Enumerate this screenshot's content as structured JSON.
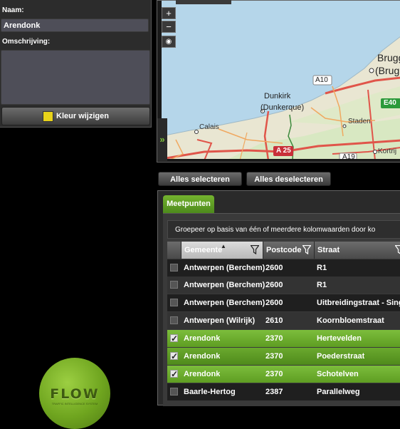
{
  "form": {
    "name_label": "Naam:",
    "name_value": "Arendonk",
    "description_label": "Omschrijving:",
    "description_value": "",
    "color_button_label": "Kleur wijzigen",
    "color_swatch": "#e8d31a"
  },
  "logo": {
    "text": "FLOW",
    "subtext": "TRAFFIC INTELLIGENCE SYSTEM"
  },
  "map": {
    "zoom_in": "+",
    "zoom_out": "−",
    "locate": "◉",
    "expand": "»",
    "labels": {
      "brugge": "Brugge",
      "brugge_local": "(Brug",
      "dunkirk": "Dunkirk",
      "dunkerque": "(Dunkerque)",
      "calais": "Calais",
      "staden": "Staden",
      "kortrijk": "Kortrij",
      "a10": "A10",
      "e40": "E40",
      "a25": "A 25",
      "a19": "A19"
    }
  },
  "actions": {
    "select_all": "Alles selecteren",
    "deselect_all": "Alles deselecteren"
  },
  "grid": {
    "tab_label": "Meetpunten",
    "group_hint": "Groepeer op basis van één of meerdere kolomwaarden door ko",
    "columns": [
      "Gemeente",
      "Postcode",
      "Straat"
    ],
    "sort_indicator": "▲",
    "rows": [
      {
        "gemeente": "Antwerpen (Berchem)",
        "postcode": "2600",
        "straat": "R1",
        "checked": false
      },
      {
        "gemeente": "Antwerpen (Berchem)",
        "postcode": "2600",
        "straat": "R1",
        "checked": false
      },
      {
        "gemeente": "Antwerpen (Berchem)",
        "postcode": "2600",
        "straat": "Uitbreidingstraat - Sing",
        "checked": false
      },
      {
        "gemeente": "Antwerpen (Wilrijk)",
        "postcode": "2610",
        "straat": "Koornbloemstraat",
        "checked": false
      },
      {
        "gemeente": "Arendonk",
        "postcode": "2370",
        "straat": "Hertevelden",
        "checked": true
      },
      {
        "gemeente": "Arendonk",
        "postcode": "2370",
        "straat": "Poederstraat",
        "checked": true
      },
      {
        "gemeente": "Arendonk",
        "postcode": "2370",
        "straat": "Schotelven",
        "checked": true
      },
      {
        "gemeente": "Baarle-Hertog",
        "postcode": "2387",
        "straat": "Parallelweg",
        "checked": false
      }
    ]
  }
}
